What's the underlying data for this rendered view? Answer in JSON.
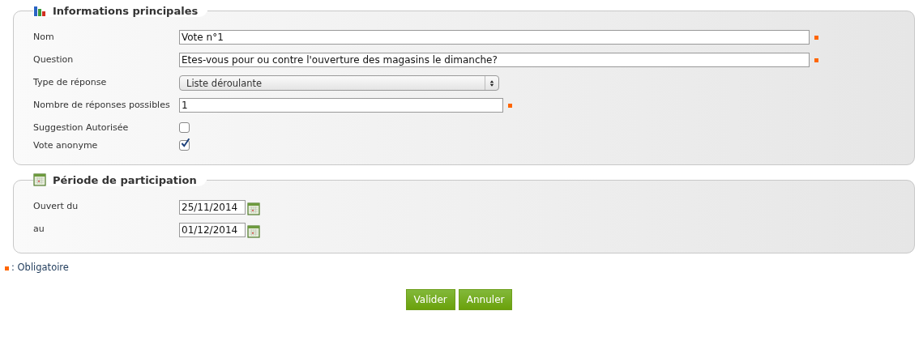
{
  "sections": [
    {
      "title": "Informations principales",
      "fields": [
        {
          "kind": "text",
          "label": "Nom",
          "value": "Vote n°1",
          "required": true
        },
        {
          "kind": "text",
          "label": "Question",
          "value": "Etes-vous pour ou contre l'ouverture des magasins le dimanche?",
          "required": true
        },
        {
          "kind": "select",
          "label": "Type de réponse",
          "value": "Liste déroulante"
        },
        {
          "kind": "number",
          "label": "Nombre de réponses possibles",
          "value": "1",
          "required": true
        },
        {
          "kind": "checkbox",
          "label": "Suggestion Autorisée",
          "checked": false
        },
        {
          "kind": "checkbox",
          "label": "Vote anonyme",
          "checked": true
        }
      ]
    },
    {
      "title": "Période de participation",
      "fields": [
        {
          "kind": "date",
          "label": "Ouvert du",
          "value": "25/11/2014"
        },
        {
          "kind": "date",
          "label": "au",
          "value": "01/12/2014"
        }
      ]
    }
  ],
  "required_note": ": Obligatoire",
  "buttons": [
    "Valider",
    "Annuler"
  ]
}
